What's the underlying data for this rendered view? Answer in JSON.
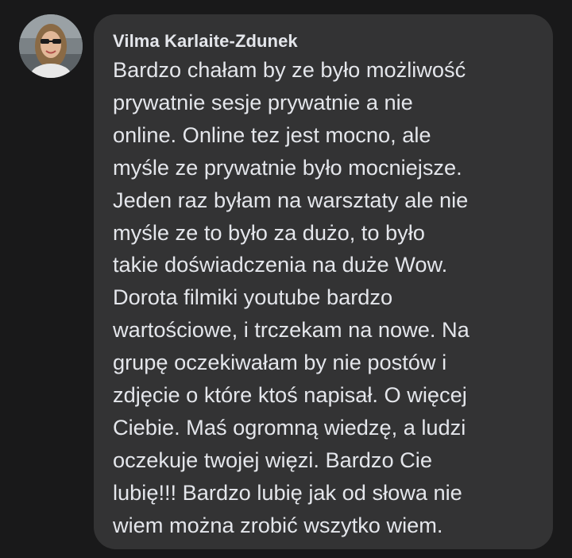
{
  "comment": {
    "author": "Vilma Karlaite-Zdunek",
    "avatar_icon": "user-profile-photo",
    "text_lines": [
      "Bardzo chałam by ze było możliwość",
      "prywatnie sesje prywatnie a nie",
      "online. Online tez jest mocno, ale",
      "myśle ze prywatnie było mocniejsze.",
      "Jeden raz byłam na warsztaty ale nie",
      "myśle ze to było za dużo, to było",
      "takie doświadczenia na duże Wow.",
      "Dorota filmiki youtube bardzo",
      "wartościowe, i trczekam na nowe. Na",
      "grupę oczekiwałam by nie postów i",
      "zdjęcie o które ktoś napisał. O więcej",
      "Ciebie. Maś ogromną wiedzę, a ludzi",
      "oczekuje twojej więzi. Bardzo Cie",
      "lubię!!! Bardzo lubię jak od słowa nie",
      "wiem można zrobić wszytko wiem."
    ]
  },
  "colors": {
    "background": "#19191a",
    "bubble": "#333334",
    "text": "#e4e6eb"
  }
}
